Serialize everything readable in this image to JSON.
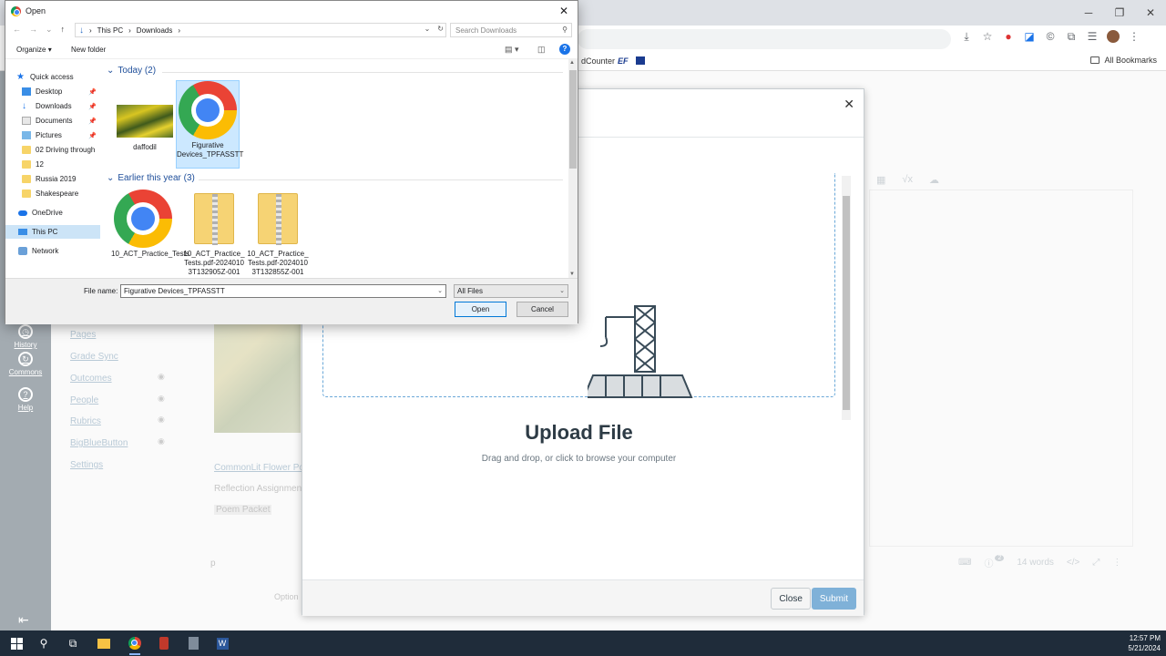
{
  "dialog": {
    "title": "Open",
    "breadcrumb": [
      "This PC",
      "Downloads"
    ],
    "search_placeholder": "Search Downloads",
    "organize_label": "Organize",
    "new_folder_label": "New folder",
    "sidebar": {
      "quick_access": "Quick access",
      "items": [
        {
          "label": "Desktop",
          "icon": "desktop-icon",
          "pinned": true
        },
        {
          "label": "Downloads",
          "icon": "download-icon",
          "pinned": true
        },
        {
          "label": "Documents",
          "icon": "documents-icon",
          "pinned": true
        },
        {
          "label": "Pictures",
          "icon": "pictures-icon",
          "pinned": true
        },
        {
          "label": "02 Driving through",
          "icon": "folder-icon",
          "pinned": false
        },
        {
          "label": "12",
          "icon": "folder-icon",
          "pinned": false
        },
        {
          "label": "Russia 2019",
          "icon": "folder-icon",
          "pinned": false
        },
        {
          "label": "Shakespeare",
          "icon": "folder-icon",
          "pinned": false
        }
      ],
      "onedrive": "OneDrive",
      "this_pc": "This PC",
      "network": "Network"
    },
    "groups": [
      {
        "header": "Today (2)",
        "files": [
          {
            "name": "daffodil",
            "type": "image"
          },
          {
            "name": "Figurative Devices_TPFASSTT",
            "type": "chrome-html",
            "selected": true
          }
        ]
      },
      {
        "header": "Earlier this year (3)",
        "files": [
          {
            "name": "10_ACT_Practice_Tests",
            "type": "chrome-html"
          },
          {
            "name": "10_ACT_Practice_Tests.pdf-20240103T132905Z-001",
            "type": "zip"
          },
          {
            "name": "10_ACT_Practice_Tests.pdf-20240103T132855Z-001",
            "type": "zip"
          }
        ]
      }
    ],
    "file_name_label": "File name:",
    "file_name_value": "Figurative Devices_TPFASSTT",
    "file_type": "All Files",
    "open_label": "Open",
    "cancel_label": "Cancel"
  },
  "browser": {
    "bookmarks": [
      "dCounter",
      "EF"
    ],
    "all_bookmarks": "All Bookmarks"
  },
  "canvas": {
    "nav": [
      {
        "label": "History",
        "icon": "clock-icon"
      },
      {
        "label": "Commons",
        "icon": "commons-icon"
      },
      {
        "label": "Help",
        "icon": "help-icon"
      }
    ],
    "course_links": [
      "Pages",
      "Grade Sync",
      "Outcomes",
      "People",
      "Rubrics",
      "BigBlueButton",
      "Settings"
    ],
    "content_links": [
      "CommonLit Flower Po",
      "Reflection Assignmen",
      "Poem Packet"
    ],
    "word_count": "14 words",
    "page_number": "p",
    "options_label": "Option",
    "badge_count": "2"
  },
  "upload_modal": {
    "title": "Upload File",
    "subtitle": "Drag and drop, or click to browse your computer",
    "close_label": "Close",
    "submit_label": "Submit"
  },
  "taskbar": {
    "time": "12:57 PM",
    "date": "5/21/2024"
  }
}
